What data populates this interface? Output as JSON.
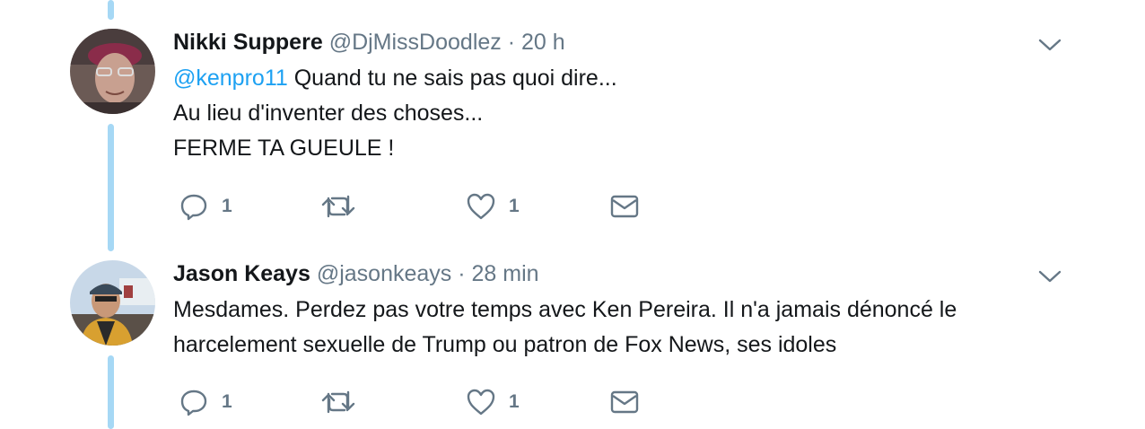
{
  "tweets": [
    {
      "name": "Nikki Suppere",
      "handle": "@DjMissDoodlez",
      "separator": "·",
      "time": "20 h",
      "mention": "@kenpro11",
      "line1_rest": " Quand tu ne sais pas quoi dire...",
      "line2": "Au lieu d'inventer des choses...",
      "line3": "FERME TA GUEULE !",
      "reply_count": "1",
      "like_count": "1"
    },
    {
      "name": "Jason Keays",
      "handle": "@jasonkeays",
      "separator": "·",
      "time": "28 min",
      "line1": "Mesdames. Perdez pas votre temps avec Ken Pereira. Il n'a jamais dénoncé le",
      "line2": "harcelement sexuelle de Trump ou patron de Fox News, ses idoles",
      "reply_count": "1",
      "like_count": "1"
    }
  ],
  "icons": {
    "reply": "reply-icon",
    "retweet": "retweet-icon",
    "like": "heart-icon",
    "message": "envelope-icon",
    "more": "chevron-down-icon"
  },
  "colors": {
    "thread_line": "#a6d8f5",
    "mention": "#1da1f2",
    "text": "#14171a",
    "meta": "#657786"
  }
}
